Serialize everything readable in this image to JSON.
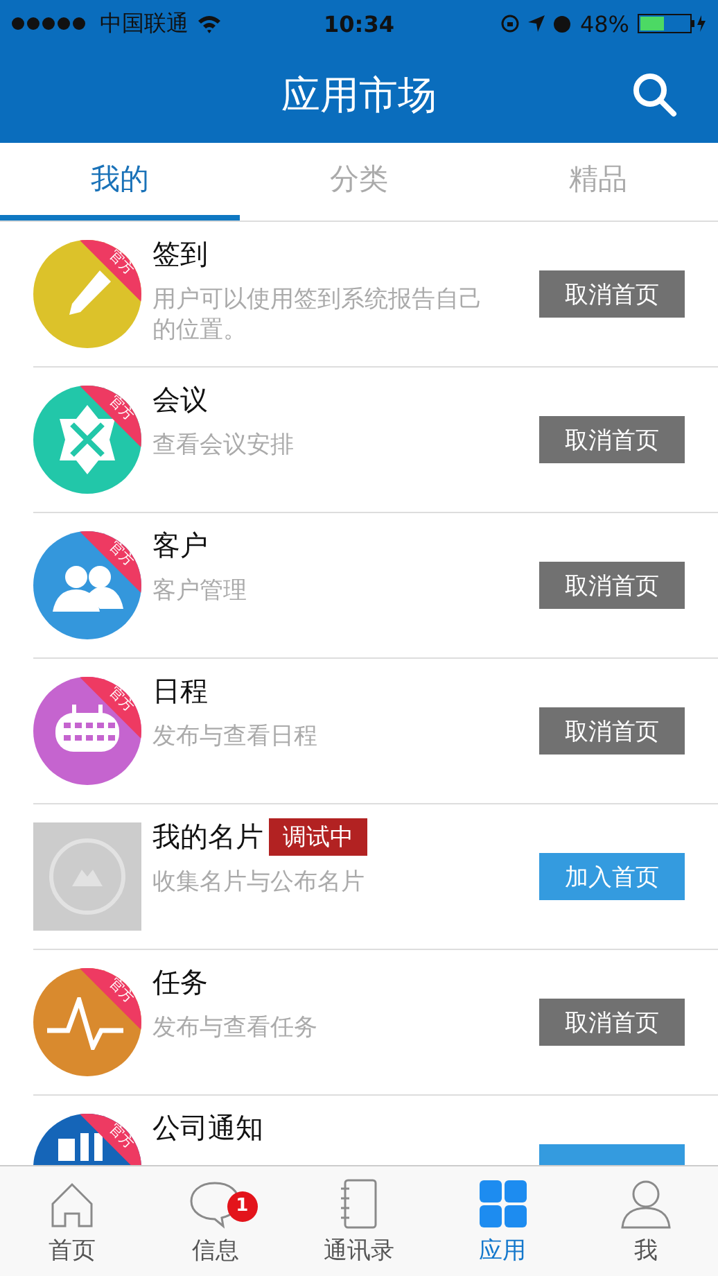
{
  "status_bar": {
    "carrier": "中国联通",
    "time": "10:34",
    "battery": "48%"
  },
  "header": {
    "title": "应用市场"
  },
  "tabs": [
    {
      "label": "我的",
      "selected": true
    },
    {
      "label": "分类",
      "selected": false
    },
    {
      "label": "精品",
      "selected": false
    }
  ],
  "apps": [
    {
      "title": "签到",
      "description": "用户可以使用签到系统报告自己的位置。",
      "color": "#dcc22a",
      "official": true,
      "ribbon": "官方",
      "action": {
        "label": "取消首页",
        "kind": "remove"
      }
    },
    {
      "title": "会议",
      "description": "查看会议安排",
      "color": "#22c7a9",
      "official": true,
      "ribbon": "官方",
      "action": {
        "label": "取消首页",
        "kind": "remove"
      }
    },
    {
      "title": "客户",
      "description": "客户管理",
      "color": "#3497dc",
      "official": true,
      "ribbon": "官方",
      "action": {
        "label": "取消首页",
        "kind": "remove"
      }
    },
    {
      "title": "日程",
      "description": "发布与查看日程",
      "color": "#c564cf",
      "official": true,
      "ribbon": "官方",
      "action": {
        "label": "取消首页",
        "kind": "remove"
      }
    },
    {
      "title": "我的名片",
      "badge": "调试中",
      "description": "收集名片与公布名片",
      "color": "#cccccc",
      "official": false,
      "action": {
        "label": "加入首页",
        "kind": "add"
      }
    },
    {
      "title": "任务",
      "description": "发布与查看任务",
      "color": "#d98a2e",
      "official": true,
      "ribbon": "官方",
      "action": {
        "label": "取消首页",
        "kind": "remove"
      }
    },
    {
      "title": "公司通知",
      "color": "#1565b8",
      "official": true,
      "ribbon": "官方",
      "action": {
        "kind": "add"
      }
    }
  ],
  "tab_bar": [
    {
      "label": "首页",
      "selected": false
    },
    {
      "label": "信息",
      "selected": false,
      "badge": "1"
    },
    {
      "label": "通讯录",
      "selected": false
    },
    {
      "label": "应用",
      "selected": true
    },
    {
      "label": "我",
      "selected": false
    }
  ]
}
